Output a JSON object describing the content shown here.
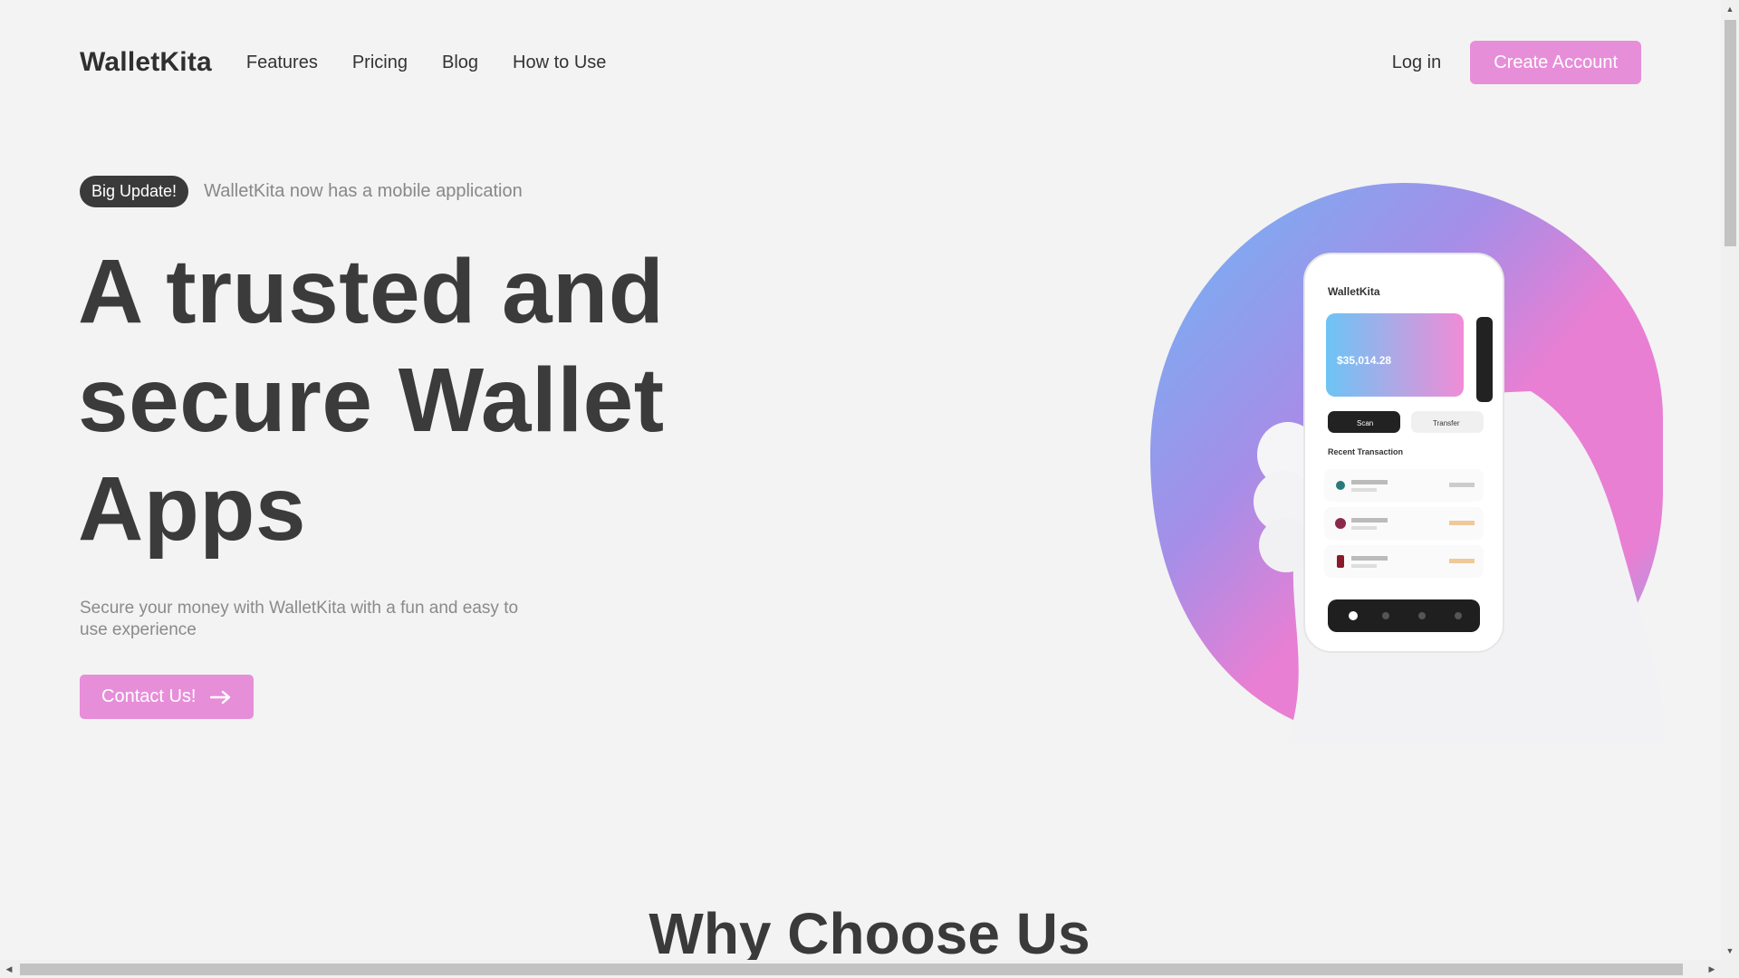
{
  "nav": {
    "logo": "WalletKita",
    "menu": [
      "Features",
      "Pricing",
      "Blog",
      "How to Use"
    ],
    "login": "Log in",
    "cta": "Create Account"
  },
  "hero": {
    "badge": "Big Update!",
    "badge_text": "WalletKita now has a mobile application",
    "title_lines": [
      "A trusted and",
      "secure Wallet",
      "Apps"
    ],
    "subtitle": "Secure your money with WalletKita with a fun and easy to use experience",
    "button": "Contact Us!",
    "button_icon": "arrow-right-icon"
  },
  "phone": {
    "app_name": "WalletKita",
    "balance": "$35,014.28",
    "buttons": [
      "Scan",
      "Transfer"
    ],
    "section": "Recent Transaction"
  },
  "section": {
    "title": "Why Choose Us"
  },
  "colors": {
    "accent": "#e78ed9",
    "dark": "#3a3a3a",
    "gradient_blue": "#6db6f5",
    "gradient_pink": "#e87fd3"
  }
}
